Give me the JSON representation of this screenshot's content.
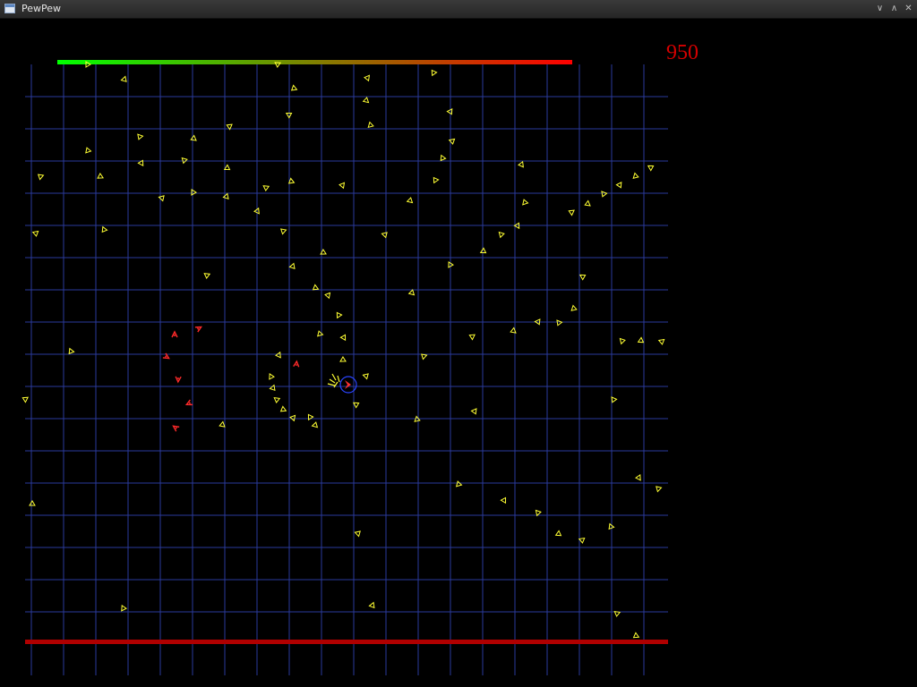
{
  "window": {
    "title": "PewPew",
    "buttons": [
      "minimize",
      "maximize",
      "close"
    ]
  },
  "hud": {
    "score": "950",
    "health_fraction": 1.0,
    "health_gradient": [
      "#00ff00",
      "#ff0000"
    ],
    "shield_bar_color": "#b00000"
  },
  "colors": {
    "background": "#000000",
    "grid": "#2a3a9c",
    "enemy_yellow": "#ffff33",
    "enemy_red": "#ff2a2a",
    "player_ring": "#2a44ff"
  }
}
